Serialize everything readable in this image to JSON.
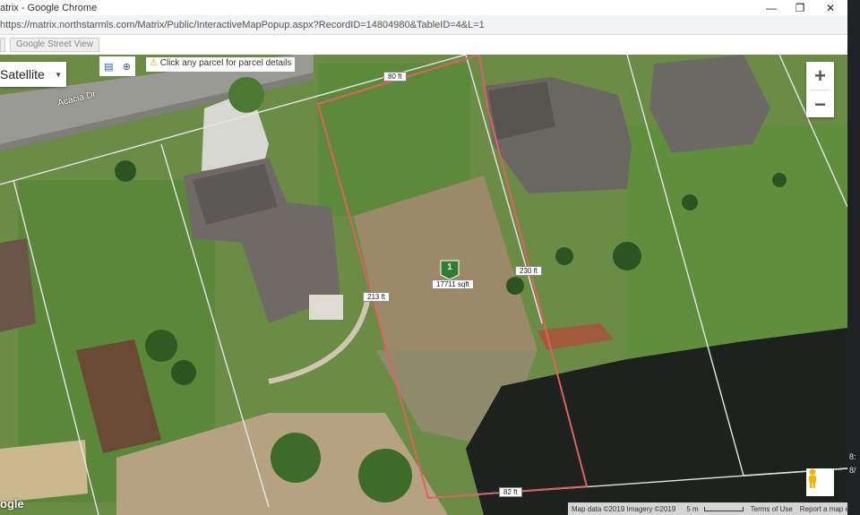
{
  "window": {
    "title": "atrix - Google Chrome",
    "url": "https://matrix.northstarmls.com/Matrix/Public/InteractiveMapPopup.aspx?RecordID=14804980&TableID=4&L=1",
    "street_view_tab": "Google Street View"
  },
  "map": {
    "map_type": "Satellite",
    "hint": "Click any parcel for parcel details",
    "street_label": "Acacia Dr",
    "zoom_in": "+",
    "zoom_out": "−",
    "marker_number": "1",
    "area_label": "17711 sqft",
    "dimensions": {
      "top": "80 ft",
      "right": "230 ft",
      "left": "213 ft",
      "bottom": "82 ft"
    },
    "logo": "ogle",
    "attribution": {
      "data": "Map data ©2019 Imagery ©2019",
      "scale": "5 m",
      "terms": "Terms of Use",
      "report": "Report a map error"
    }
  },
  "taskbar": {
    "time_fragment": "8:",
    "date_fragment": "8/"
  },
  "colors": {
    "parcel_outline": "#e06060",
    "lot_lines": "#e8e8e8",
    "marker": "#2e7d32",
    "water": "#1c1f1c"
  }
}
